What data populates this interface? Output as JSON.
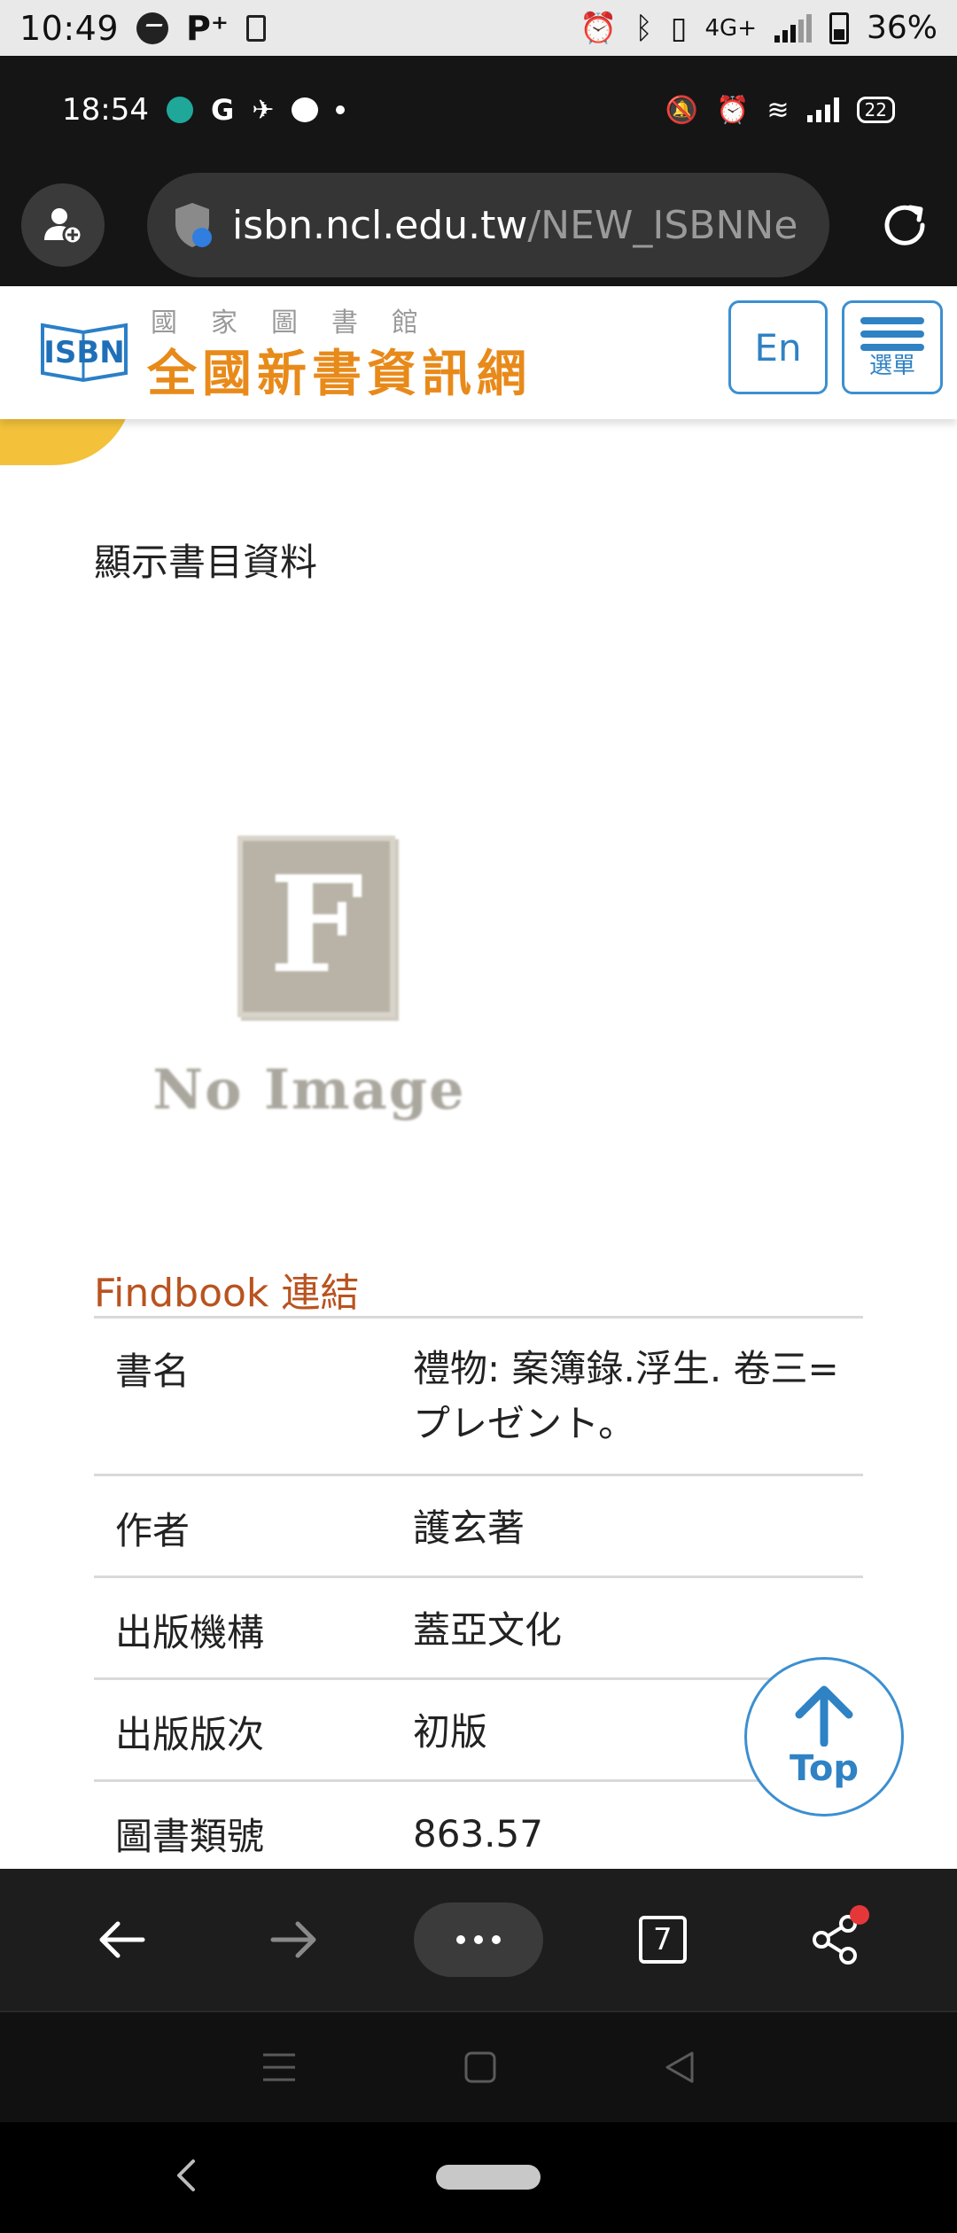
{
  "outer_status": {
    "time": "10:49",
    "network": "4G+",
    "battery": "36%"
  },
  "inner_status": {
    "time": "18:54",
    "google_letter": "G",
    "battery": "22"
  },
  "browser": {
    "url_host": "isbn.ncl.edu.tw",
    "url_path": "/NEW_ISBNNe",
    "tab_count": "7"
  },
  "header": {
    "logo_text": "ISBN",
    "subtitle": "國家圖書館",
    "site_name": "全國新書資訊網",
    "en_label": "En",
    "menu_label": "選單"
  },
  "main": {
    "section_title": "顯示書目資料",
    "no_image_letter": "F",
    "no_image_caption": "No Image",
    "findbook_title": "Findbook 連結",
    "rows": [
      {
        "label": "書名",
        "value": "禮物: 案簿錄.浮生. 卷三= プレゼント。"
      },
      {
        "label": "作者",
        "value": "護玄著"
      },
      {
        "label": "出版機構",
        "value": "蓋亞文化"
      },
      {
        "label": "出版版次",
        "value": "初版"
      },
      {
        "label": "圖書類號",
        "value": "863.57"
      }
    ],
    "top_button_label": "Top"
  },
  "colors": {
    "accent_blue": "#2f82c4",
    "site_orange": "#e88a1a",
    "findbook_brown": "#b9531f",
    "notification_red": "#e5373a"
  }
}
